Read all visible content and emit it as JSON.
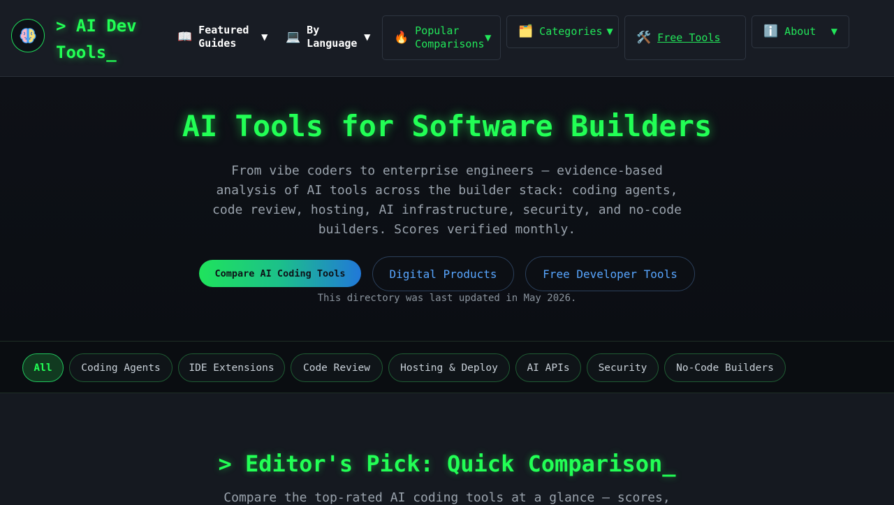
{
  "header": {
    "logo_text": "> AI Dev Tools_",
    "logo_icon": "brain-icon",
    "nav": [
      {
        "icon": "📖",
        "icon_name": "book-icon",
        "label": "Featured Guides",
        "caret": "▼"
      },
      {
        "icon": "💻",
        "icon_name": "laptop-icon",
        "label": "By Language",
        "caret": "▼"
      },
      {
        "icon": "🔥",
        "icon_name": "fire-icon",
        "label": "Popular Comparisons",
        "caret": "▼"
      },
      {
        "icon": "🗂️",
        "icon_name": "folder-icon",
        "label": "Categories",
        "caret": "▼"
      },
      {
        "icon": "🛠️",
        "icon_name": "tools-icon",
        "label": "Free Tools"
      },
      {
        "icon": "ℹ️",
        "icon_name": "info-icon",
        "label": "About",
        "caret": "▼"
      }
    ]
  },
  "hero": {
    "title": "AI Tools for Software Builders",
    "subtitle": "From vibe coders to enterprise engineers — evidence-based analysis of AI tools across the builder stack: coding agents, code review, hosting, AI infrastructure, security, and no-code builders. Scores verified monthly.",
    "primary_button": "Compare AI Coding Tools",
    "secondary_buttons": [
      "Digital Products",
      "Free Developer Tools"
    ],
    "updated_note": "This directory was last updated in May 2026."
  },
  "filters": {
    "chips": [
      "All",
      "Coding Agents",
      "IDE Extensions",
      "Code Review",
      "Hosting & Deploy",
      "AI APIs",
      "Security",
      "No-Code Builders"
    ],
    "active": "All"
  },
  "editors_pick": {
    "title": "> Editor's Pick: Quick Comparison_",
    "subtitle": "Compare the top-rated AI coding tools at a glance — scores,"
  },
  "colors": {
    "accent_green": "#22ff55",
    "link_blue": "#58a6ff",
    "background": "#151920"
  }
}
